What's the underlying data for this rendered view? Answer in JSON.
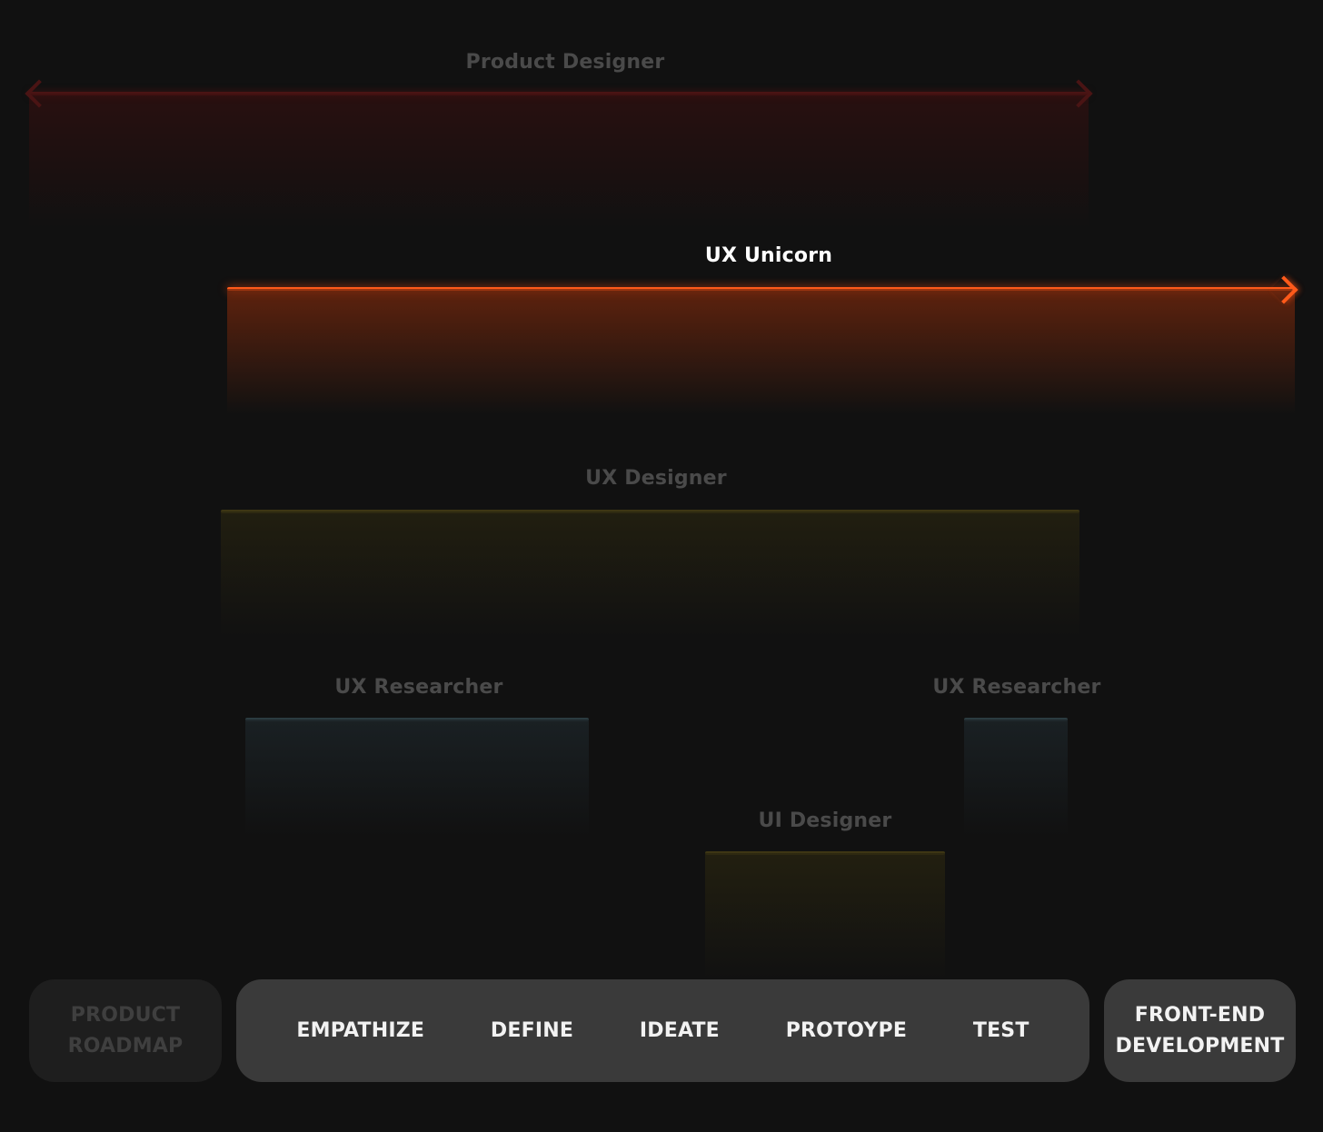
{
  "roles": {
    "product_designer": {
      "label": "Product Designer",
      "color": "#4a1414"
    },
    "ux_unicorn": {
      "label": "UX Unicorn",
      "color": "#ff5a1a"
    },
    "ux_designer": {
      "label": "UX Designer",
      "color": "#3d3614"
    },
    "ux_researcher_left": {
      "label": "UX Researcher",
      "color": "#2b3b40"
    },
    "ux_researcher_right": {
      "label": "UX Researcher",
      "color": "#2b3b40"
    },
    "ui_designer": {
      "label": "UI Designer",
      "color": "#3d3614"
    }
  },
  "phases": {
    "roadmap": {
      "line1": "PRODUCT",
      "line2": "ROADMAP"
    },
    "stages": [
      "EMPATHIZE",
      "DEFINE",
      "IDEATE",
      "PROTOYPE",
      "TEST"
    ],
    "frontend": {
      "line1": "FRONT-END",
      "line2": "DEVELOPMENT"
    }
  },
  "colors": {
    "background": "#111111",
    "accent": "#ff5a1a",
    "dim_text": "#4a4a4a",
    "phase_box": "#3a3a3a"
  }
}
